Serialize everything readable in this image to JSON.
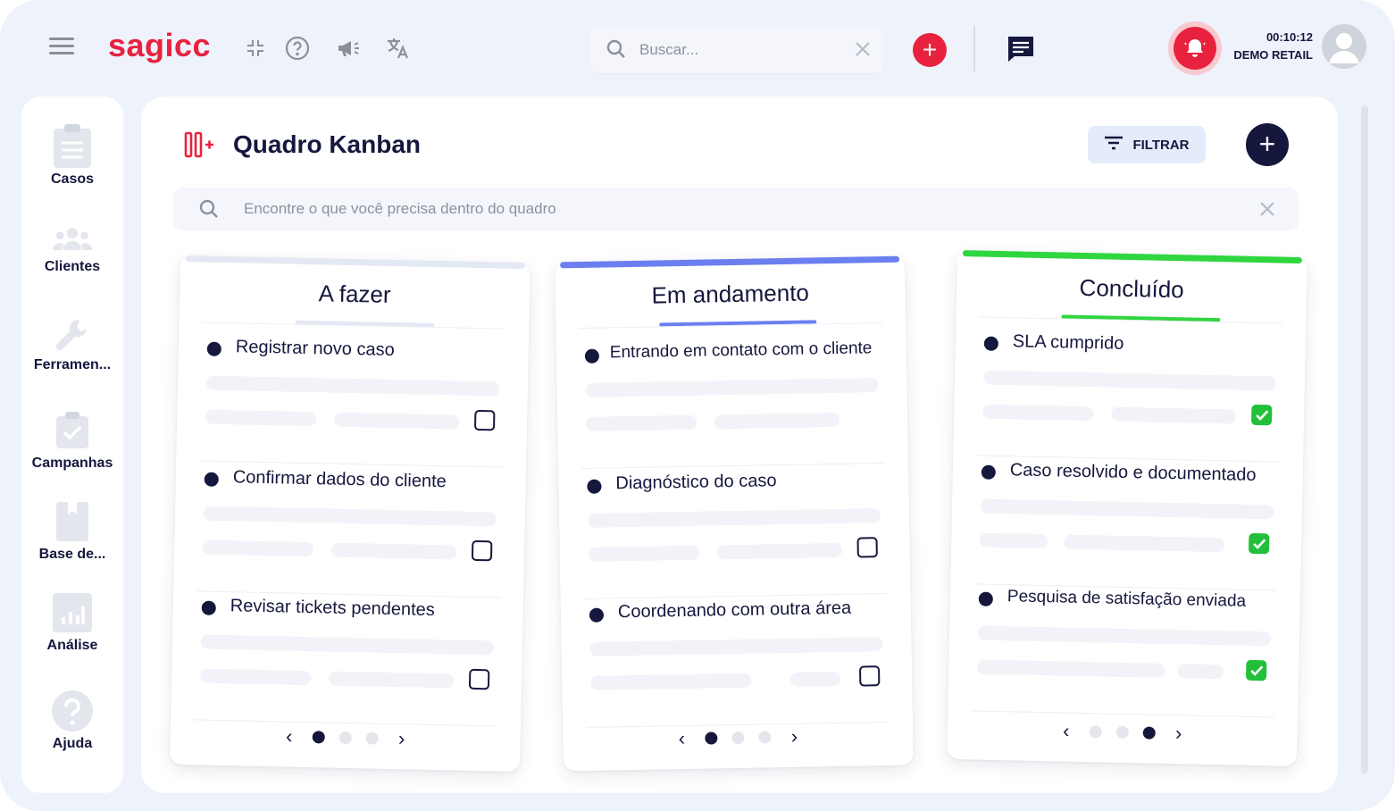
{
  "app": {
    "logo": "sagicc",
    "search_placeholder": "Buscar...",
    "timer": "00:10:12",
    "company": "DEMO RETAIL"
  },
  "sidebar": {
    "items": [
      {
        "label": "Casos",
        "icon": "clipboard-icon"
      },
      {
        "label": "Clientes",
        "icon": "people-icon"
      },
      {
        "label": "Ferramen...",
        "icon": "wrench-icon"
      },
      {
        "label": "Campanhas",
        "icon": "clipboard-check-icon"
      },
      {
        "label": "Base de...",
        "icon": "book-icon"
      },
      {
        "label": "Análise",
        "icon": "chart-icon"
      },
      {
        "label": "Ajuda",
        "icon": "help-icon"
      }
    ]
  },
  "board": {
    "title": "Quadro Kanban",
    "filter_label": "FILTRAR",
    "search_placeholder": "Encontre o que você precisa dentro do quadro",
    "columns": [
      {
        "title": "A fazer",
        "accent": "#e3e8f4",
        "cards": [
          {
            "title": "Registrar novo caso",
            "checked": false
          },
          {
            "title": "Confirmar dados do cliente",
            "checked": false
          },
          {
            "title": "Revisar tickets pendentes",
            "checked": false
          }
        ],
        "page": 1
      },
      {
        "title": "Em andamento",
        "accent": "#6c7ff0",
        "cards": [
          {
            "title": "Entrando em contato com o cliente",
            "checked": false
          },
          {
            "title": "Diagnóstico do caso",
            "checked": false
          },
          {
            "title": "Coordenando com outra área",
            "checked": false
          }
        ],
        "page": 1
      },
      {
        "title": "Concluído",
        "accent": "#2fd63f",
        "cards": [
          {
            "title": "SLA cumprido",
            "checked": true
          },
          {
            "title": "Caso resolvido e documentado",
            "checked": true
          },
          {
            "title": "Pesquisa de satisfação enviada",
            "checked": true
          }
        ],
        "page": 3
      }
    ]
  },
  "colors": {
    "brand_red": "#e8223e",
    "navy": "#15173d",
    "done_green": "#22c03a"
  }
}
